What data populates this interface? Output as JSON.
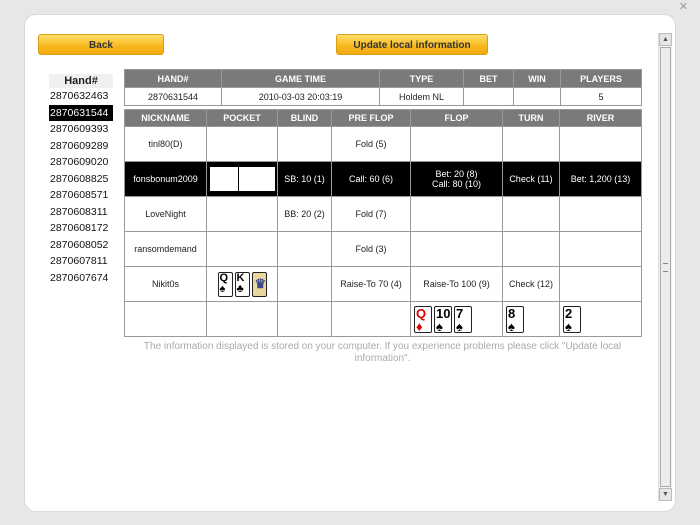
{
  "buttons": {
    "back": "Back",
    "update": "Update local information"
  },
  "hand_list": {
    "header": "Hand#",
    "items": [
      "2870632463",
      "2870631544",
      "2870609393",
      "2870609289",
      "2870609020",
      "2870608825",
      "2870608571",
      "2870608311",
      "2870608172",
      "2870608052",
      "2870607811",
      "2870607674"
    ],
    "selected_index": 1
  },
  "info": {
    "headers": [
      "HAND#",
      "GAME TIME",
      "TYPE",
      "BET",
      "WIN",
      "PLAYERS"
    ],
    "row": [
      "2870631544",
      "2010-03-03 20:03:19",
      "Holdem NL",
      "",
      "",
      "5"
    ]
  },
  "players": {
    "headers": [
      "NICKNAME",
      "POCKET",
      "BLIND",
      "PRE FLOP",
      "FLOP",
      "TURN",
      "RIVER"
    ],
    "rows": [
      {
        "nick": "tinl80(D)",
        "blind": "",
        "preflop": "Fold (5)",
        "flop": "",
        "turn": "",
        "river": ""
      },
      {
        "nick": "fonsbonum2009",
        "blind": "SB: 10 (1)",
        "preflop": "Call: 60 (6)",
        "flop": "Bet: 20 (8)",
        "flop2": "Call: 80 (10)",
        "turn": "Check (11)",
        "river": "Bet: 1,200 (13)"
      },
      {
        "nick": "LoveNight",
        "blind": "BB: 20 (2)",
        "preflop": "Fold (7)",
        "flop": "",
        "turn": "",
        "river": ""
      },
      {
        "nick": "ransomdemand",
        "blind": "",
        "preflop": "Fold (3)",
        "flop": "",
        "turn": "",
        "river": ""
      },
      {
        "nick": "Nikit0s",
        "blind": "",
        "preflop": "Raise-To 70 (4)",
        "flop": "Raise-To 100 (9)",
        "turn": "Check (12)",
        "river": ""
      }
    ]
  },
  "cards": {
    "pocket": [
      {
        "rank": "Q",
        "suit": "♠",
        "color": "black"
      },
      {
        "rank": "K",
        "suit": "♣",
        "color": "black"
      },
      {
        "rank": "",
        "suit": "",
        "color": "face",
        "icon": "jack-figure-icon"
      }
    ],
    "flop": [
      {
        "rank": "Q",
        "suit": "♦",
        "color": "red"
      },
      {
        "rank": "10",
        "suit": "♠",
        "color": "black"
      },
      {
        "rank": "7",
        "suit": "♠",
        "color": "black"
      }
    ],
    "turn": [
      {
        "rank": "8",
        "suit": "♠",
        "color": "black"
      }
    ],
    "river": [
      {
        "rank": "2",
        "suit": "♠",
        "color": "black"
      }
    ]
  },
  "notice": "The information displayed is stored on your computer. If you experience problems please click \"Update local information\".",
  "colors": {
    "button_gold": "#f7b71d",
    "header_gray": "#7a7a7a",
    "highlight_row": "#000000"
  }
}
